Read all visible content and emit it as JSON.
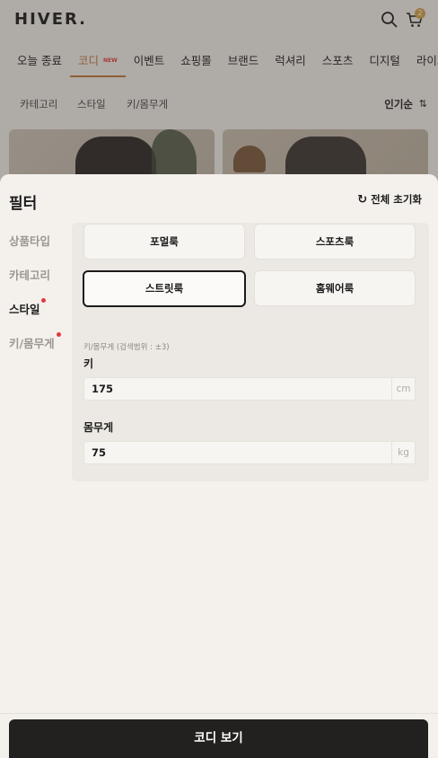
{
  "app": {
    "logo": "HIVER.",
    "cart_count": "2",
    "nav": [
      {
        "label": "오늘 종료"
      },
      {
        "label": "코디",
        "badge": "NEW"
      },
      {
        "label": "이벤트"
      },
      {
        "label": "쇼핑몰"
      },
      {
        "label": "브랜드"
      },
      {
        "label": "럭셔리"
      },
      {
        "label": "스포츠"
      },
      {
        "label": "디지털"
      },
      {
        "label": "라이프"
      }
    ],
    "subfilters": [
      "카테고리",
      "스타일",
      "키/몸무게"
    ],
    "sort_label": "인기순",
    "accent_color": "#c07a3a"
  },
  "filter": {
    "title": "필터",
    "reset_label": "전체 초기화",
    "sidebar": [
      {
        "label": "상품타입"
      },
      {
        "label": "카테고리"
      },
      {
        "label": "스타일",
        "active": true,
        "dot": true
      },
      {
        "label": "키/몸무게",
        "dot": true
      }
    ],
    "style_options": [
      "포멀룩",
      "스포츠룩",
      "스트릿룩",
      "홈웨어룩"
    ],
    "selected_option": "스트릿룩",
    "body": {
      "hint": "키/몸무게 (검색범위 : ±3)",
      "height_label": "키",
      "height_value": "175",
      "height_unit": "cm",
      "weight_label": "몸무게",
      "weight_value": "75",
      "weight_unit": "kg"
    },
    "cta_label": "코디 보기"
  }
}
